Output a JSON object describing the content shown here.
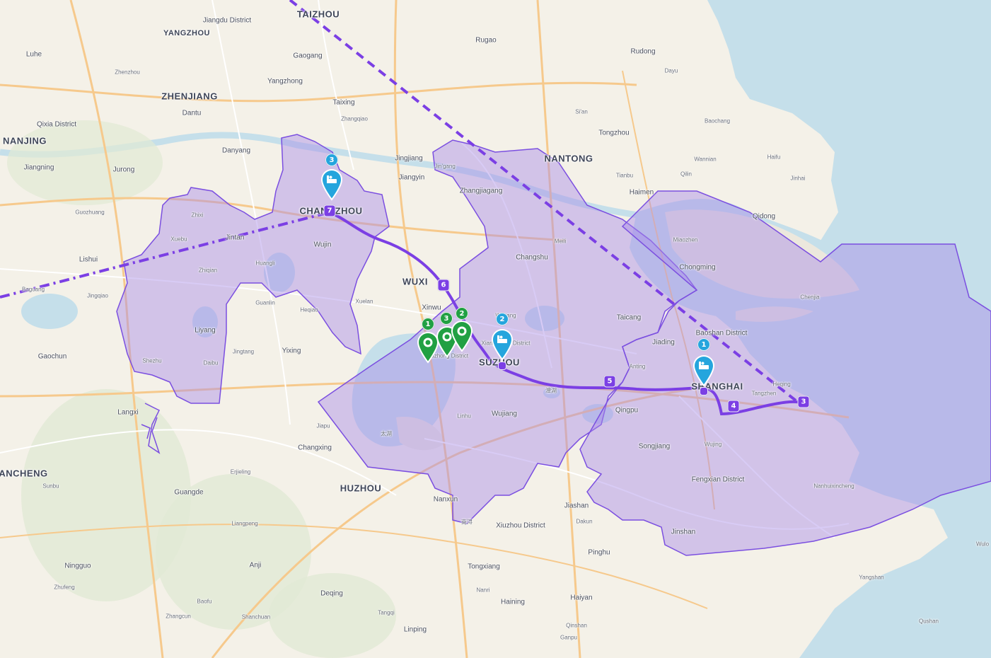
{
  "labels": [
    {
      "text": "TAIZHOU",
      "kind": "city"
    },
    {
      "text": "Jiangdu District",
      "kind": "town"
    },
    {
      "text": "YANGZHOU",
      "kind": "city-sm"
    },
    {
      "text": "Luhe",
      "kind": "town"
    },
    {
      "text": "Gaogang",
      "kind": "town"
    },
    {
      "text": "Rugao",
      "kind": "town"
    },
    {
      "text": "Rudong",
      "kind": "town"
    },
    {
      "text": "Dayu",
      "kind": "tiny"
    },
    {
      "text": "Zhenzhou",
      "kind": "tiny"
    },
    {
      "text": "Yangzhong",
      "kind": "town"
    },
    {
      "text": "ZHENJIANG",
      "kind": "city"
    },
    {
      "text": "Dantu",
      "kind": "town"
    },
    {
      "text": "Taixing",
      "kind": "town"
    },
    {
      "text": "Zhangqiao",
      "kind": "tiny"
    },
    {
      "text": "Si'an",
      "kind": "tiny"
    },
    {
      "text": "Tongzhou",
      "kind": "town"
    },
    {
      "text": "Baochang",
      "kind": "tiny"
    },
    {
      "text": "Qixia District",
      "kind": "town"
    },
    {
      "text": "NANJING",
      "kind": "city"
    },
    {
      "text": "Danyang",
      "kind": "town"
    },
    {
      "text": "Jingjiang",
      "kind": "town"
    },
    {
      "text": "NANTONG",
      "kind": "city"
    },
    {
      "text": "Wannian",
      "kind": "tiny"
    },
    {
      "text": "Haifu",
      "kind": "tiny"
    },
    {
      "text": "Jiangning",
      "kind": "town"
    },
    {
      "text": "Jurong",
      "kind": "town"
    },
    {
      "text": "Jin'gang",
      "kind": "tiny"
    },
    {
      "text": "Jiangyin",
      "kind": "town"
    },
    {
      "text": "Tianbu",
      "kind": "tiny"
    },
    {
      "text": "Qilin",
      "kind": "tiny"
    },
    {
      "text": "Jinhai",
      "kind": "tiny"
    },
    {
      "text": "Zhangjiagang",
      "kind": "town"
    },
    {
      "text": "Haimen",
      "kind": "town"
    },
    {
      "text": "Guozhuang",
      "kind": "tiny"
    },
    {
      "text": "Zhixi",
      "kind": "tiny"
    },
    {
      "text": "CHANGZHOU",
      "kind": "city"
    },
    {
      "text": "Qidong",
      "kind": "town"
    },
    {
      "text": "Xuebu",
      "kind": "tiny"
    },
    {
      "text": "Jintan",
      "kind": "town"
    },
    {
      "text": "Meili",
      "kind": "tiny"
    },
    {
      "text": "Miaozhen",
      "kind": "tiny"
    },
    {
      "text": "Wujin",
      "kind": "town"
    },
    {
      "text": "Lishui",
      "kind": "town"
    },
    {
      "text": "Huangli",
      "kind": "tiny"
    },
    {
      "text": "Changshu",
      "kind": "town"
    },
    {
      "text": "Chongming",
      "kind": "town"
    },
    {
      "text": "Zhiqian",
      "kind": "tiny"
    },
    {
      "text": "WUXI",
      "kind": "city"
    },
    {
      "text": "Baguang",
      "kind": "tiny"
    },
    {
      "text": "Jingqiao",
      "kind": "tiny"
    },
    {
      "text": "Guanlin",
      "kind": "tiny"
    },
    {
      "text": "Xuelan",
      "kind": "tiny"
    },
    {
      "text": "Chenjia",
      "kind": "tiny"
    },
    {
      "text": "Heqiao",
      "kind": "tiny"
    },
    {
      "text": "Xinwu",
      "kind": "town"
    },
    {
      "text": "Weitang",
      "kind": "tiny"
    },
    {
      "text": "Taicang",
      "kind": "town"
    },
    {
      "text": "Liyang",
      "kind": "town"
    },
    {
      "text": "Baoshan District",
      "kind": "town"
    },
    {
      "text": "Xiangcheng District",
      "kind": "tiny"
    },
    {
      "text": "Jiading",
      "kind": "town"
    },
    {
      "text": "Gaochun",
      "kind": "town"
    },
    {
      "text": "Jingtang",
      "kind": "tiny"
    },
    {
      "text": "Yixing",
      "kind": "town"
    },
    {
      "text": "Wuzhong District",
      "kind": "tiny"
    },
    {
      "text": "SUZHOU",
      "kind": "city"
    },
    {
      "text": "Shezhu",
      "kind": "tiny"
    },
    {
      "text": "Daibu",
      "kind": "tiny"
    },
    {
      "text": "Anting",
      "kind": "tiny"
    },
    {
      "text": "SHANGHAI",
      "kind": "city"
    },
    {
      "text": "Heqing",
      "kind": "tiny"
    },
    {
      "text": "Tangzhen",
      "kind": "tiny"
    },
    {
      "text": "澄湖",
      "kind": "tiny"
    },
    {
      "text": "Qingpu",
      "kind": "town"
    },
    {
      "text": "Langxi",
      "kind": "town"
    },
    {
      "text": "Linhu",
      "kind": "tiny"
    },
    {
      "text": "Wujiang",
      "kind": "town"
    },
    {
      "text": "Jiapu",
      "kind": "tiny"
    },
    {
      "text": "太湖",
      "kind": "tiny"
    },
    {
      "text": "Changxing",
      "kind": "town"
    },
    {
      "text": "Songjiang",
      "kind": "town"
    },
    {
      "text": "Wujing",
      "kind": "tiny"
    },
    {
      "text": "ANCHENG",
      "kind": "city"
    },
    {
      "text": "Erjieling",
      "kind": "tiny"
    },
    {
      "text": "Sunbu",
      "kind": "tiny"
    },
    {
      "text": "Fengxian District",
      "kind": "town"
    },
    {
      "text": "Nanhuixincheng",
      "kind": "tiny"
    },
    {
      "text": "Guangde",
      "kind": "town"
    },
    {
      "text": "HUZHOU",
      "kind": "city"
    },
    {
      "text": "Nanxun",
      "kind": "town"
    },
    {
      "text": "Jiashan",
      "kind": "town"
    },
    {
      "text": "Liangpeng",
      "kind": "tiny"
    },
    {
      "text": "南浔",
      "kind": "tiny"
    },
    {
      "text": "Xiuzhou District",
      "kind": "town"
    },
    {
      "text": "Dakun",
      "kind": "tiny"
    },
    {
      "text": "Jinshan",
      "kind": "town"
    },
    {
      "text": "Wulo",
      "kind": "tiny"
    },
    {
      "text": "Pinghu",
      "kind": "town"
    },
    {
      "text": "Ningguo",
      "kind": "town"
    },
    {
      "text": "Anji",
      "kind": "town"
    },
    {
      "text": "Tongxiang",
      "kind": "town"
    },
    {
      "text": "Yangshan",
      "kind": "tiny"
    },
    {
      "text": "Zhufeng",
      "kind": "tiny"
    },
    {
      "text": "Nanri",
      "kind": "tiny"
    },
    {
      "text": "Deqing",
      "kind": "town"
    },
    {
      "text": "Haiyan",
      "kind": "town"
    },
    {
      "text": "Baofu",
      "kind": "tiny"
    },
    {
      "text": "Haining",
      "kind": "town"
    },
    {
      "text": "Zhangcun",
      "kind": "tiny"
    },
    {
      "text": "Shanchuan",
      "kind": "tiny"
    },
    {
      "text": "Tangqi",
      "kind": "tiny"
    },
    {
      "text": "Qinshan",
      "kind": "tiny"
    },
    {
      "text": "Qushan",
      "kind": "tiny"
    },
    {
      "text": "Linping",
      "kind": "town"
    },
    {
      "text": "Ganpu",
      "kind": "tiny"
    }
  ],
  "markers": {
    "blue_pins": [
      {
        "id": "lodging-changzhou",
        "badge": "3",
        "icon": "bed-icon"
      },
      {
        "id": "lodging-suzhou",
        "badge": "2",
        "icon": "bed-icon"
      },
      {
        "id": "lodging-shanghai",
        "badge": "1",
        "icon": "bed-icon"
      }
    ],
    "green_pins": [
      {
        "id": "poi-1",
        "badge": "1"
      },
      {
        "id": "poi-3",
        "badge": "3"
      },
      {
        "id": "poi-2",
        "badge": "2"
      }
    ],
    "route_stops": [
      "7",
      "6",
      "5",
      "4",
      "3"
    ]
  },
  "colors": {
    "route": "#7b3fe4",
    "region_fill": "#a98be8",
    "region_stroke": "#7b4fe0",
    "blue_pin": "#25a5dd",
    "green_pin": "#21a043",
    "water": "#c5dfea",
    "land": "#f4f1e8",
    "road_major": "#f6c98c",
    "road_minor": "#ffffff"
  }
}
